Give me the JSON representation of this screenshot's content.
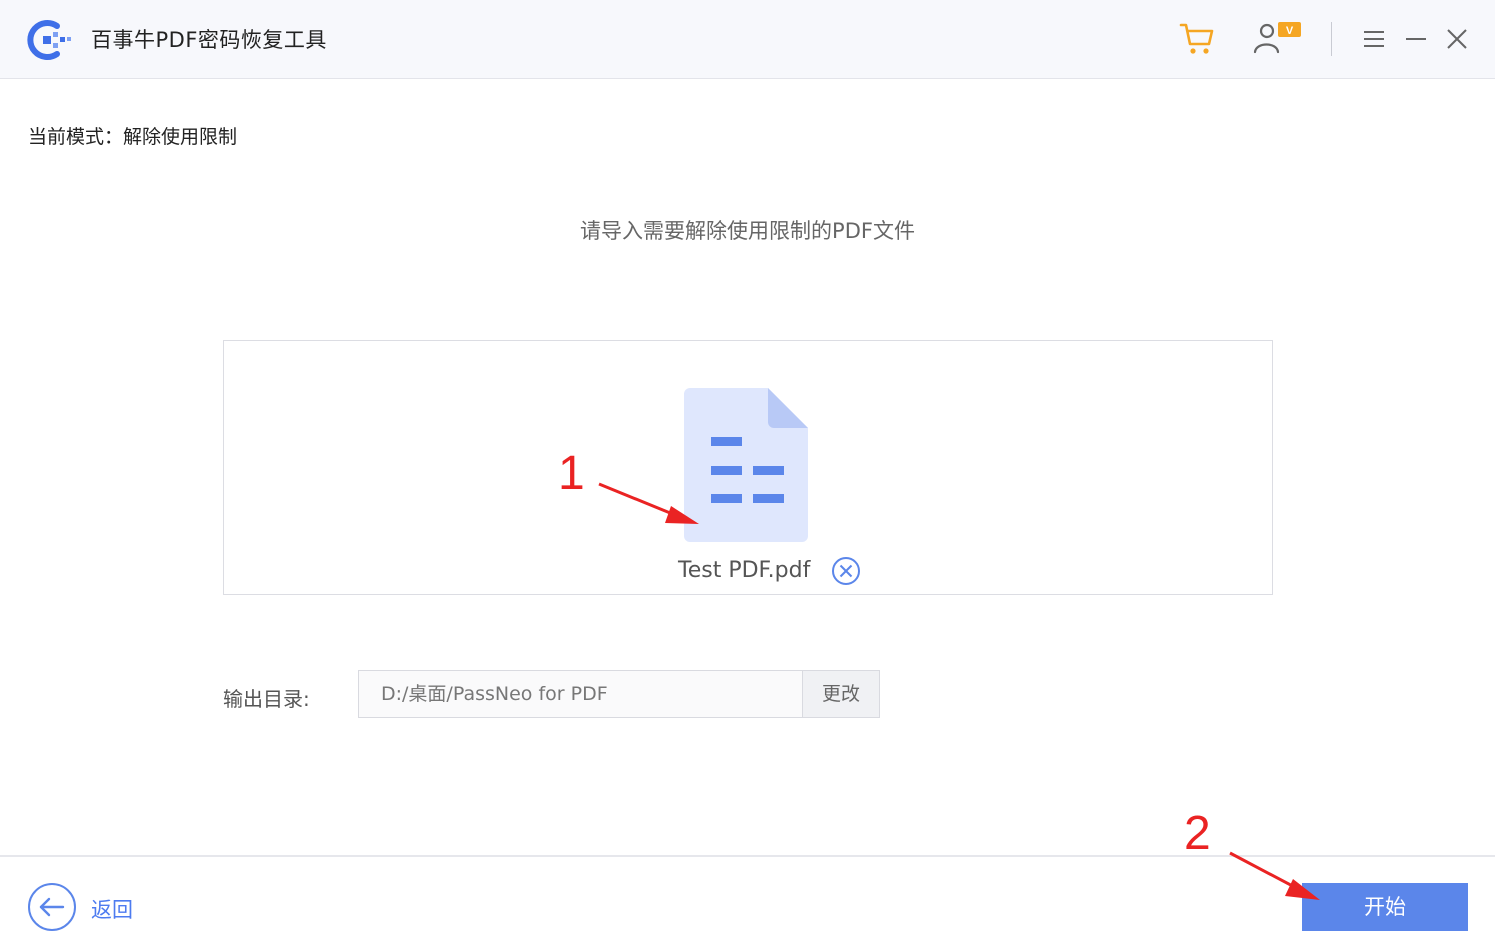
{
  "app": {
    "title": "百事牛PDF密码恢复工具"
  },
  "titlebar": {
    "icons": [
      "cart-icon",
      "user-vip-icon",
      "menu-icon",
      "minimize-icon",
      "close-icon"
    ]
  },
  "mode": {
    "label": "当前模式：解除使用限制"
  },
  "prompt": "请导入需要解除使用限制的PDF文件",
  "file": {
    "name": "Test PDF.pdf"
  },
  "output": {
    "label": "输出目录:",
    "path": "D:/桌面/PassNeo for PDF",
    "change_label": "更改"
  },
  "footer": {
    "back_label": "返回",
    "start_label": "开始"
  },
  "annotations": {
    "step1": "1",
    "step2": "2"
  },
  "colors": {
    "accent": "#5b86ea",
    "cart": "#f5a623",
    "annotation": "#ea2323",
    "file_icon_bg": "#dfe7fd",
    "file_icon_lines": "#5b86ea"
  }
}
